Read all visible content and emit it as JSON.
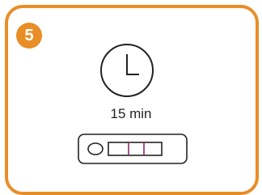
{
  "step": {
    "number": "5"
  },
  "timer": {
    "icon": "clock-icon",
    "duration_label": "15 min"
  },
  "device": {
    "icon": "test-cassette-icon",
    "result_lines": 2
  },
  "colors": {
    "accent": "#e98d26",
    "line": "#222222",
    "result_line": "#8a2a6a"
  }
}
